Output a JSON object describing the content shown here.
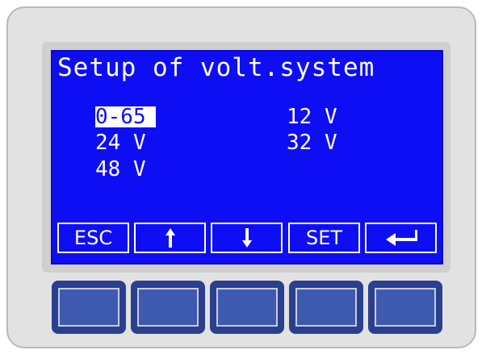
{
  "screen": {
    "title": "Setup of volt.system",
    "options": [
      {
        "label": "0-65",
        "selected": true
      },
      {
        "label": "24 V",
        "selected": false
      },
      {
        "label": "48 V",
        "selected": false
      },
      {
        "label": "12 V",
        "selected": false
      },
      {
        "label": "32 V",
        "selected": false
      }
    ]
  },
  "softkeys": [
    {
      "label": "ESC",
      "icon": null
    },
    {
      "label": "",
      "icon": "arrow-up-icon"
    },
    {
      "label": "",
      "icon": "arrow-down-icon"
    },
    {
      "label": "SET",
      "icon": null
    },
    {
      "label": "",
      "icon": "enter-icon"
    }
  ],
  "colors": {
    "screen_bg": "#0e0ef5",
    "screen_fg": "#ffffff",
    "hw_button": "#2a3f8f",
    "device_body": "#e2e2e2"
  }
}
